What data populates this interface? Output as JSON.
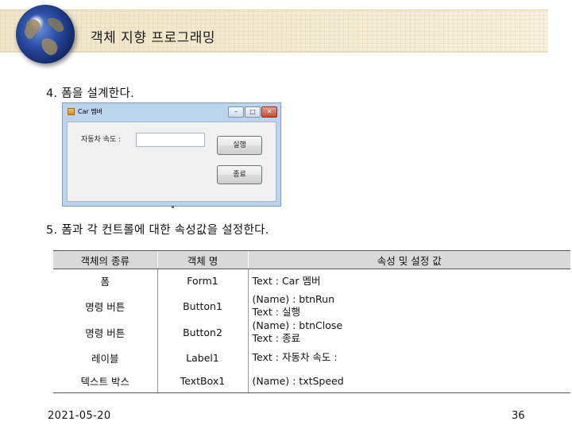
{
  "header": {
    "title": "객체 지향 프로그래밍"
  },
  "steps": {
    "step4": "4. 폼을 설계한다.",
    "step5": "5. 폼과 각 컨트롤에 대한 속성값을 설정한다."
  },
  "dialog": {
    "title": "Car 멤버",
    "label": "자동차 속도 :",
    "textbox_value": "",
    "run_button": "실행",
    "close_button": "종료",
    "minimize_glyph": "–",
    "maximize_glyph": "□",
    "close_glyph": "✕"
  },
  "table": {
    "headers": [
      "객체의 종류",
      "객체 명",
      "속성 및 설정 값"
    ],
    "rows": [
      {
        "kind": "폼",
        "name": "Form1",
        "props": [
          "Text : Car 멤버"
        ]
      },
      {
        "kind": "명령 버튼",
        "name": "Button1",
        "props": [
          "(Name) : btnRun",
          "Text : 실행"
        ]
      },
      {
        "kind": "명령 버튼",
        "name": "Button2",
        "props": [
          "(Name) : btnClose",
          "Text : 종료"
        ]
      },
      {
        "kind": "레이블",
        "name": "Label1",
        "props": [
          "Text : 자동차 속도 :"
        ]
      },
      {
        "kind": "텍스트 박스",
        "name": "TextBox1",
        "props": [
          "(Name) : txtSpeed"
        ]
      }
    ]
  },
  "footer": {
    "date": "2021-05-20",
    "page": "36"
  }
}
